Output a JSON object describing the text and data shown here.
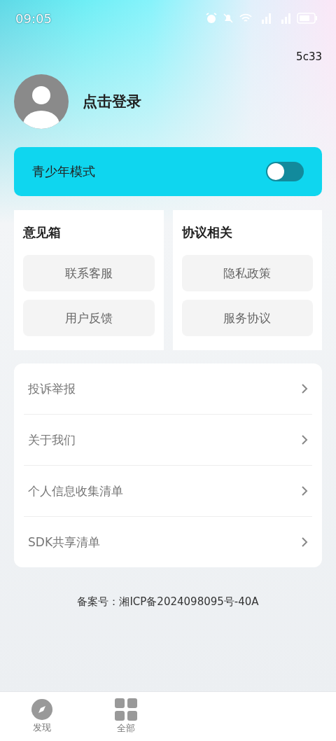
{
  "status_bar": {
    "time": "09:05"
  },
  "version": "5c33",
  "profile": {
    "login_label": "点击登录"
  },
  "teen_mode": {
    "label": "青少年模式",
    "on": false
  },
  "groups": [
    {
      "title": "意见箱",
      "buttons": [
        "联系客服",
        "用户反馈"
      ]
    },
    {
      "title": "协议相关",
      "buttons": [
        "隐私政策",
        "服务协议"
      ]
    }
  ],
  "menu": [
    {
      "label": "投诉举报"
    },
    {
      "label": "关于我们"
    },
    {
      "label": "个人信息收集清单"
    },
    {
      "label": "SDK共享清单"
    }
  ],
  "filing": "备案号：湘ICP备2024098095号-40A",
  "bottom_nav": [
    {
      "label": "发现",
      "kind": "compass",
      "selected": false
    },
    {
      "label": "全部",
      "kind": "grid",
      "selected": false
    }
  ]
}
